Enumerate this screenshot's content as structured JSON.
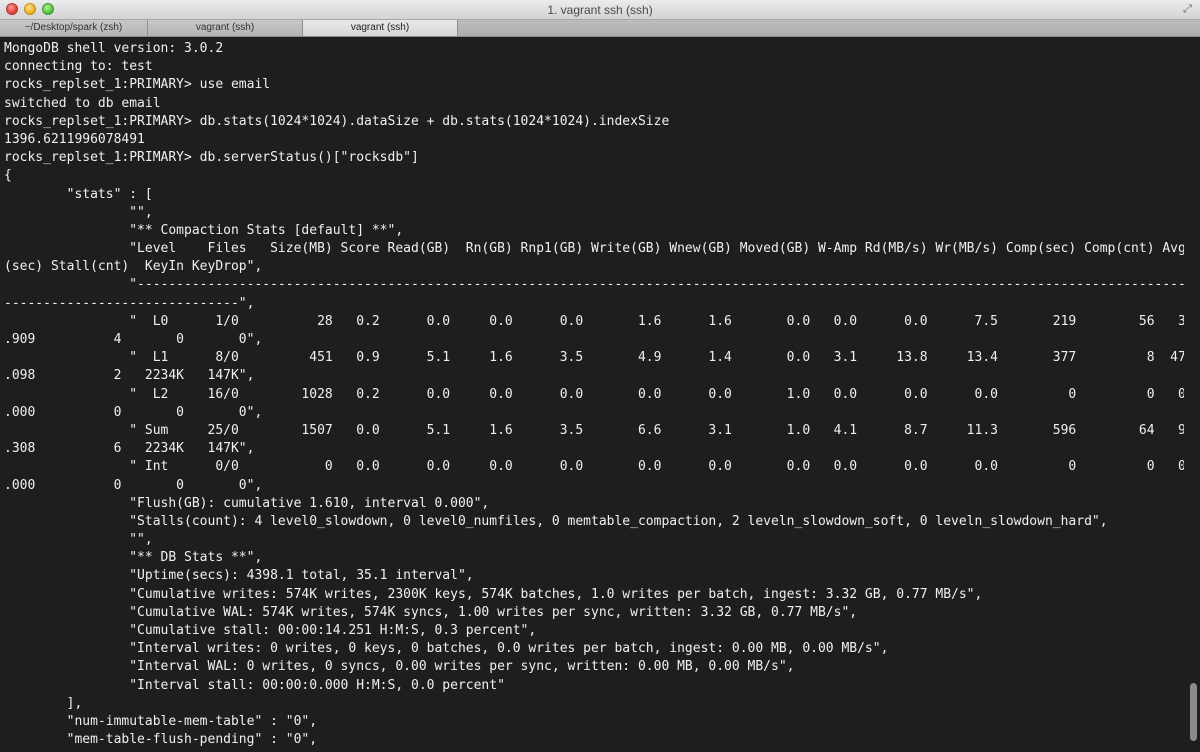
{
  "window": {
    "title": "1. vagrant ssh (ssh)"
  },
  "tabs": [
    {
      "label": "~/Desktop/spark (zsh)",
      "active": false
    },
    {
      "label": "vagrant (ssh)",
      "active": false
    },
    {
      "label": "vagrant (ssh)",
      "active": true
    }
  ],
  "icons": {
    "close": "close-icon",
    "minimize": "minimize-icon",
    "maximize": "zoom-icon",
    "fullscreen": "fullscreen-icon"
  },
  "colors": {
    "terminal_bg": "#1e1e1e",
    "terminal_fg": "#f0f0f0",
    "close": "#e0443e",
    "minimize": "#f0b42c",
    "maximize": "#54c43e"
  },
  "terminal": {
    "lines": [
      "MongoDB shell version: 3.0.2",
      "connecting to: test",
      "rocks_replset_1:PRIMARY> use email",
      "switched to db email",
      "rocks_replset_1:PRIMARY> db.stats(1024*1024).dataSize + db.stats(1024*1024).indexSize",
      "1396.6211996078491",
      "rocks_replset_1:PRIMARY> db.serverStatus()[\"rocksdb\"]",
      "{",
      "        \"stats\" : [",
      "                \"\",",
      "                \"** Compaction Stats [default] **\",",
      "                \"Level    Files   Size(MB) Score Read(GB)  Rn(GB) Rnp1(GB) Write(GB) Wnew(GB) Moved(GB) W-Amp Rd(MB/s) Wr(MB/s) Comp(sec) Comp(cnt) Avg",
      "(sec) Stall(cnt)  KeyIn KeyDrop\",",
      "                \"--------------------------------------------------------------------------------------------------------------------------------------------------",
      "------------------------------\",",
      "                \"  L0      1/0          28   0.2      0.0     0.0      0.0       1.6      1.6       0.0   0.0      0.0      7.5       219        56   3",
      ".909          4       0       0\",",
      "                \"  L1      8/0         451   0.9      5.1     1.6      3.5       4.9      1.4       0.0   3.1     13.8     13.4       377         8  47",
      ".098          2   2234K   147K\",",
      "                \"  L2     16/0        1028   0.2      0.0     0.0      0.0       0.0      0.0       1.0   0.0      0.0      0.0         0         0   0",
      ".000          0       0       0\",",
      "                \" Sum     25/0        1507   0.0      5.1     1.6      3.5       6.6      3.1       1.0   4.1      8.7     11.3       596        64   9",
      ".308          6   2234K   147K\",",
      "                \" Int      0/0           0   0.0      0.0     0.0      0.0       0.0      0.0       0.0   0.0      0.0      0.0         0         0   0",
      ".000          0       0       0\",",
      "                \"Flush(GB): cumulative 1.610, interval 0.000\",",
      "                \"Stalls(count): 4 level0_slowdown, 0 level0_numfiles, 0 memtable_compaction, 2 leveln_slowdown_soft, 0 leveln_slowdown_hard\",",
      "                \"\",",
      "                \"** DB Stats **\",",
      "                \"Uptime(secs): 4398.1 total, 35.1 interval\",",
      "                \"Cumulative writes: 574K writes, 2300K keys, 574K batches, 1.0 writes per batch, ingest: 3.32 GB, 0.77 MB/s\",",
      "                \"Cumulative WAL: 574K writes, 574K syncs, 1.00 writes per sync, written: 3.32 GB, 0.77 MB/s\",",
      "                \"Cumulative stall: 00:00:14.251 H:M:S, 0.3 percent\",",
      "                \"Interval writes: 0 writes, 0 keys, 0 batches, 0.0 writes per batch, ingest: 0.00 MB, 0.00 MB/s\",",
      "                \"Interval WAL: 0 writes, 0 syncs, 0.00 writes per sync, written: 0.00 MB, 0.00 MB/s\",",
      "                \"Interval stall: 00:00:0.000 H:M:S, 0.0 percent\"",
      "        ],",
      "        \"num-immutable-mem-table\" : \"0\",",
      "        \"mem-table-flush-pending\" : \"0\","
    ]
  }
}
